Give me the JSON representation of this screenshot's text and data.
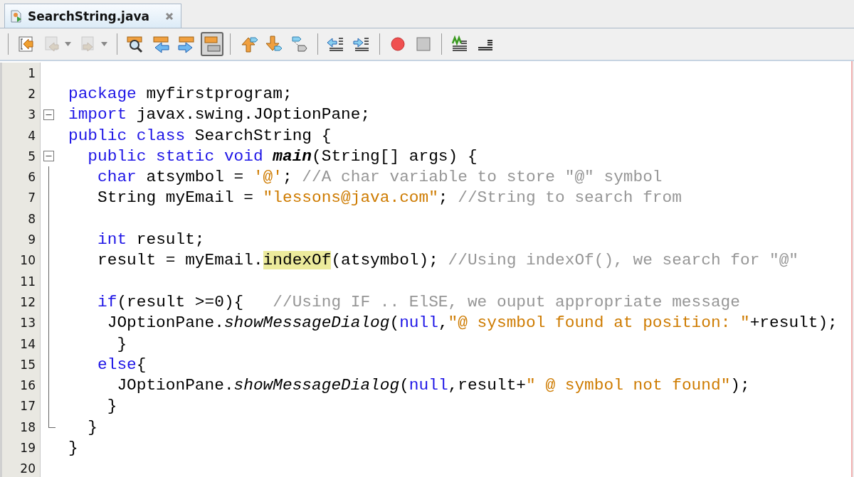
{
  "tab": {
    "title": "SearchString.java",
    "selected": true
  },
  "toolbar": {
    "groups": [
      [
        {
          "kind": "jump-back",
          "disabled": false,
          "selected": false
        },
        {
          "kind": "back",
          "disabled": true,
          "selected": false
        },
        {
          "kind": "forward",
          "disabled": true,
          "selected": false
        }
      ],
      [
        {
          "kind": "find",
          "disabled": false,
          "selected": false
        },
        {
          "kind": "find-prev",
          "disabled": false,
          "selected": false
        },
        {
          "kind": "find-next",
          "disabled": false,
          "selected": false
        },
        {
          "kind": "highlight",
          "disabled": false,
          "selected": true
        }
      ],
      [
        {
          "kind": "prev-bookmark",
          "disabled": false,
          "selected": false
        },
        {
          "kind": "next-bookmark",
          "disabled": false,
          "selected": false
        },
        {
          "kind": "toggle-bookmark",
          "disabled": false,
          "selected": false
        }
      ],
      [
        {
          "kind": "shift-left",
          "disabled": false,
          "selected": false
        },
        {
          "kind": "shift-right",
          "disabled": false,
          "selected": false
        }
      ],
      [
        {
          "kind": "record",
          "disabled": false,
          "selected": false
        },
        {
          "kind": "stop",
          "disabled": false,
          "selected": false
        }
      ],
      [
        {
          "kind": "comment",
          "disabled": false,
          "selected": false
        },
        {
          "kind": "uncomment",
          "disabled": false,
          "selected": false
        }
      ]
    ]
  },
  "lines": [
    {
      "number": "1",
      "kind": "plain"
    },
    {
      "number": "2",
      "kind": "plain",
      "tokens": [
        {
          "t": "package",
          "kind": "kw"
        },
        {
          "t": " myfirstprogram;",
          "kind": "plain"
        }
      ]
    },
    {
      "number": "3",
      "kind": "fold-start",
      "tokens": [
        {
          "t": "import",
          "kind": "kw"
        },
        {
          "t": " javax.swing.JOptionPane;",
          "kind": "plain"
        }
      ]
    },
    {
      "number": "4",
      "kind": "plain",
      "tokens": [
        {
          "t": "public class",
          "kind": "kw"
        },
        {
          "t": " SearchString {",
          "kind": "plain"
        }
      ]
    },
    {
      "number": "5",
      "kind": "fold-start",
      "tokens": [
        {
          "t": "  public static void",
          "kind": "kw"
        },
        {
          "t": " main",
          "kind": "decl"
        },
        {
          "t": "(String[] args) {",
          "kind": "plain"
        }
      ]
    },
    {
      "number": "6",
      "kind": "fold-inside",
      "tokens": [
        {
          "t": "   char",
          "kind": "kw"
        },
        {
          "t": " atsymbol = ",
          "kind": "plain"
        },
        {
          "t": "'@'",
          "kind": "str"
        },
        {
          "t": "; ",
          "kind": "plain"
        },
        {
          "t": "//A char variable to store \"@\" symbol",
          "kind": "cmt"
        }
      ]
    },
    {
      "number": "7",
      "kind": "fold-inside",
      "tokens": [
        {
          "t": "   String myEmail = ",
          "kind": "plain"
        },
        {
          "t": "\"lessons@java.com\"",
          "kind": "str"
        },
        {
          "t": "; ",
          "kind": "plain"
        },
        {
          "t": "//String to search from",
          "kind": "cmt"
        }
      ]
    },
    {
      "number": "8",
      "kind": "fold-inside"
    },
    {
      "number": "9",
      "kind": "fold-inside",
      "tokens": [
        {
          "t": "   int",
          "kind": "kw"
        },
        {
          "t": " result;",
          "kind": "plain"
        }
      ]
    },
    {
      "number": "10",
      "kind": "fold-inside",
      "tokens": [
        {
          "t": "   result = myEmail.",
          "kind": "plain"
        },
        {
          "t": "indexOf",
          "kind": "mark"
        },
        {
          "t": "(atsymbol); ",
          "kind": "plain"
        },
        {
          "t": "//Using indexOf(), we search for \"@\"",
          "kind": "cmt"
        }
      ]
    },
    {
      "number": "11",
      "kind": "fold-inside"
    },
    {
      "number": "12",
      "kind": "fold-inside",
      "tokens": [
        {
          "t": "   if",
          "kind": "kw"
        },
        {
          "t": "(result >=0){   ",
          "kind": "plain"
        },
        {
          "t": "//Using IF .. ElSE, we ouput appropriate message",
          "kind": "cmt"
        }
      ]
    },
    {
      "number": "13",
      "kind": "fold-inside",
      "tokens": [
        {
          "t": "    JOptionPane.",
          "kind": "plain"
        },
        {
          "t": "showMessageDialog",
          "kind": "ital"
        },
        {
          "t": "(",
          "kind": "plain"
        },
        {
          "t": "null",
          "kind": "kw"
        },
        {
          "t": ",",
          "kind": "plain"
        },
        {
          "t": "\"@ sysmbol found at position: \"",
          "kind": "str"
        },
        {
          "t": "+result);",
          "kind": "plain"
        }
      ]
    },
    {
      "number": "14",
      "kind": "fold-inside",
      "tokens": [
        {
          "t": "     }",
          "kind": "plain"
        }
      ]
    },
    {
      "number": "15",
      "kind": "fold-inside",
      "tokens": [
        {
          "t": "   else",
          "kind": "kw"
        },
        {
          "t": "{",
          "kind": "plain"
        }
      ]
    },
    {
      "number": "16",
      "kind": "fold-inside",
      "tokens": [
        {
          "t": "     JOptionPane.",
          "kind": "plain"
        },
        {
          "t": "showMessageDialog",
          "kind": "ital"
        },
        {
          "t": "(",
          "kind": "plain"
        },
        {
          "t": "null",
          "kind": "kw"
        },
        {
          "t": ",result+",
          "kind": "plain"
        },
        {
          "t": "\" @ symbol not found\"",
          "kind": "str"
        },
        {
          "t": ");",
          "kind": "plain"
        }
      ]
    },
    {
      "number": "17",
      "kind": "fold-inside",
      "tokens": [
        {
          "t": "    }",
          "kind": "plain"
        }
      ]
    },
    {
      "number": "18",
      "kind": "fold-end",
      "tokens": [
        {
          "t": "  }",
          "kind": "plain"
        }
      ]
    },
    {
      "number": "19",
      "kind": "plain",
      "tokens": [
        {
          "t": "}",
          "kind": "plain"
        }
      ]
    },
    {
      "number": "20",
      "kind": "plain"
    }
  ]
}
